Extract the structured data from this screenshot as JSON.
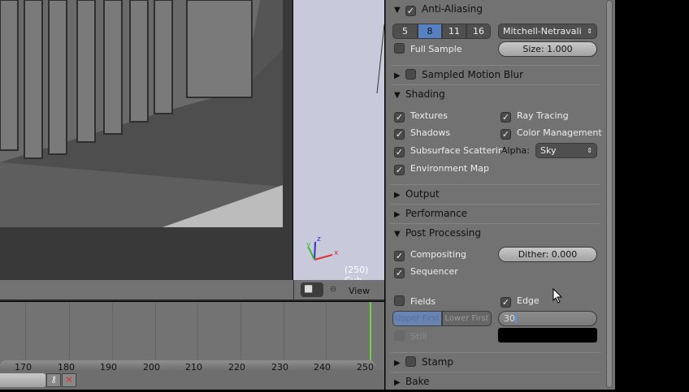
{
  "properties": {
    "anti_aliasing": {
      "title": "Anti-Aliasing",
      "enabled": true,
      "samples": [
        "5",
        "8",
        "11",
        "16"
      ],
      "selected_sample": "8",
      "filter": "Mitchell-Netravali",
      "full_sample": "Full Sample",
      "full_sample_checked": false,
      "size": "Size: 1.000"
    },
    "motion_blur": {
      "title": "Sampled Motion Blur",
      "enabled": false
    },
    "shading": {
      "title": "Shading",
      "textures": "Textures",
      "ray_tracing": "Ray Tracing",
      "shadows": "Shadows",
      "color_management": "Color Management",
      "sss": "Subsurface Scatterin",
      "alpha_label": "Alpha:",
      "alpha_value": "Sky",
      "env_map": "Environment Map"
    },
    "output": {
      "title": "Output"
    },
    "performance": {
      "title": "Performance"
    },
    "post_processing": {
      "title": "Post Processing",
      "compositing": "Compositing",
      "dither": "Dither: 0.000",
      "sequencer": "Sequencer",
      "fields": "Fields",
      "edge": "Edge",
      "upper_first": "Upper First",
      "lower_first": "Lower First",
      "edge_threshold": "30",
      "still": "Still"
    },
    "stamp": {
      "title": "Stamp",
      "enabled": false
    },
    "bake": {
      "title": "Bake"
    }
  },
  "viewport": {
    "object_info": "(250) Cub",
    "axes": {
      "x": "x",
      "y": "y",
      "z": "z"
    },
    "menu_view": "View"
  },
  "timeline": {
    "ticks": [
      "170",
      "180",
      "190",
      "200",
      "210",
      "220",
      "230",
      "240",
      "250"
    ],
    "current_frame": 250,
    "accent": "#6ed43c"
  }
}
